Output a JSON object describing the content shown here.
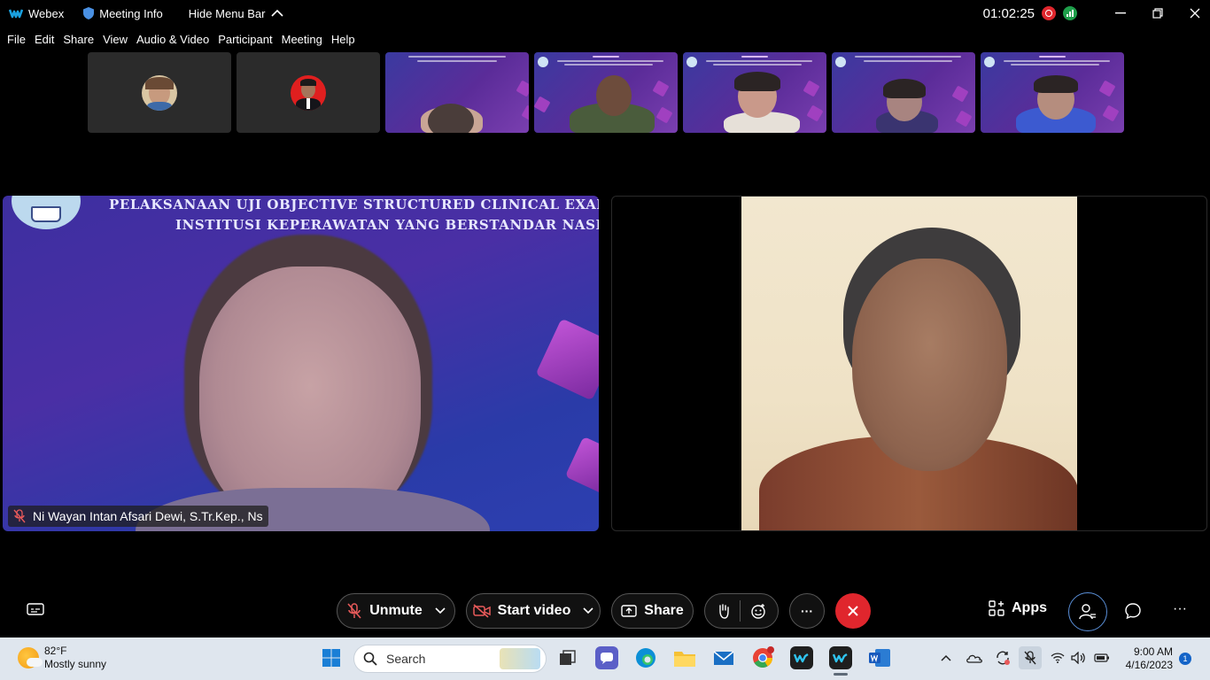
{
  "titlebar": {
    "app_name": "Webex",
    "meeting_info": "Meeting Info",
    "hide_menu": "Hide Menu Bar",
    "timer": "01:02:25"
  },
  "menu": [
    "File",
    "Edit",
    "Share",
    "View",
    "Audio & Video",
    "Participant",
    "Meeting",
    "Help"
  ],
  "main": {
    "left_slide_line1": "PELAKSANAAN UJI OBJECTIVE STRUCTURED CLINICAL EXAMINATIO",
    "left_slide_line2": "INSTITUSI KEPERAWATAN YANG BERSTANDAR NASIONAL",
    "left_participant_name": "Ni Wayan Intan Afsari Dewi, S.Tr.Kep., Ns"
  },
  "controls": {
    "unmute_label": "Unmute",
    "start_video_label": "Start video",
    "share_label": "Share",
    "apps_label": "Apps",
    "more_label": "···"
  },
  "taskbar": {
    "weather_temp": "82°F",
    "weather_desc": "Mostly sunny",
    "search_label": "Search",
    "time": "9:00 AM",
    "date": "4/16/2023",
    "notification_count": "1"
  },
  "colors": {
    "end_call": "#e0262d",
    "slide_bg": "#3d2fa0",
    "accent_blue": "#5a8fd8"
  }
}
